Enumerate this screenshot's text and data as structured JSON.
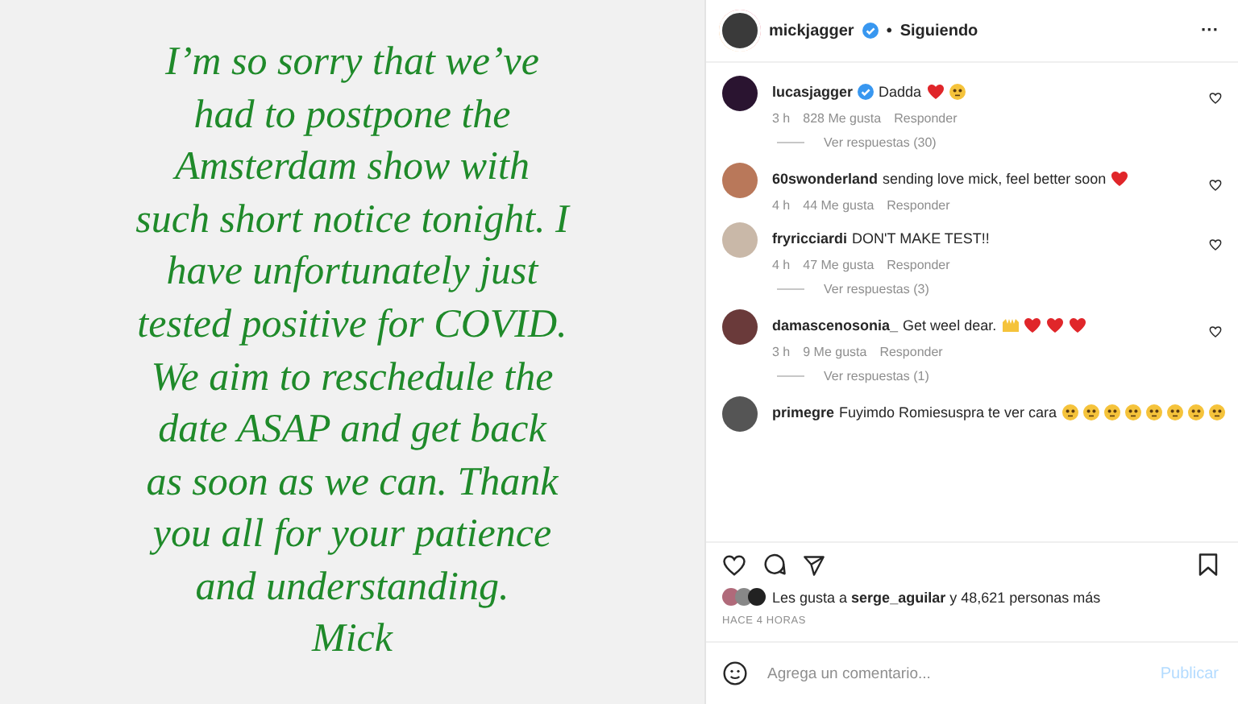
{
  "story": {
    "text": "I’m so sorry that we’ve\nhad to postpone the\nAmsterdam show with\nsuch short notice tonight. I\nhave unfortunately just\ntested positive for COVID.\nWe aim to reschedule the\ndate ASAP and get back\nas soon as we can. Thank\nyou all for your patience\nand understanding.\nMick"
  },
  "header": {
    "username": "mickjagger",
    "verified": true,
    "separator": "•",
    "follow": "Siguiendo",
    "more": "···"
  },
  "comments": [
    {
      "username": "lucasjagger",
      "verified": true,
      "text": "Dadda",
      "emojis": [
        {
          "kind": "heart"
        },
        {
          "kind": "face"
        }
      ],
      "time": "3 h",
      "likes": "828 Me gusta",
      "reply": "Responder",
      "replies": "Ver respuestas (30)"
    },
    {
      "username": "60swonderland",
      "verified": false,
      "text": "sending love mick, feel better soon",
      "emojis": [
        {
          "kind": "heart"
        }
      ],
      "time": "4 h",
      "likes": "44 Me gusta",
      "reply": "Responder"
    },
    {
      "username": "fryricciardi",
      "verified": false,
      "text": "DON'T MAKE TEST!!",
      "time": "4 h",
      "likes": "47 Me gusta",
      "reply": "Responder",
      "replies": "Ver respuestas (3)"
    },
    {
      "username": "damascenosonia_",
      "verified": false,
      "text": "Get weel dear.",
      "emojis": [
        {
          "kind": "hands"
        },
        {
          "kind": "heart"
        },
        {
          "kind": "heart"
        },
        {
          "kind": "heart"
        }
      ],
      "time": "3 h",
      "likes": "9 Me gusta",
      "reply": "Responder",
      "replies": "Ver respuestas (1)"
    },
    {
      "username": "primegre",
      "verified": false,
      "text": "Fuyimdo Romiesuspra te ver cara",
      "emojis": [
        {
          "kind": "face"
        },
        {
          "kind": "face"
        },
        {
          "kind": "face"
        },
        {
          "kind": "face"
        },
        {
          "kind": "face"
        },
        {
          "kind": "face"
        },
        {
          "kind": "face"
        },
        {
          "kind": "face"
        }
      ]
    }
  ],
  "likes": {
    "prefix": "Les gusta a ",
    "user": "serge_aguilar",
    "suffix": " y 48,621 personas más"
  },
  "timestamp": "HACE 4 HORAS",
  "composer": {
    "placeholder": "Agrega un comentario...",
    "submit": "Publicar"
  }
}
